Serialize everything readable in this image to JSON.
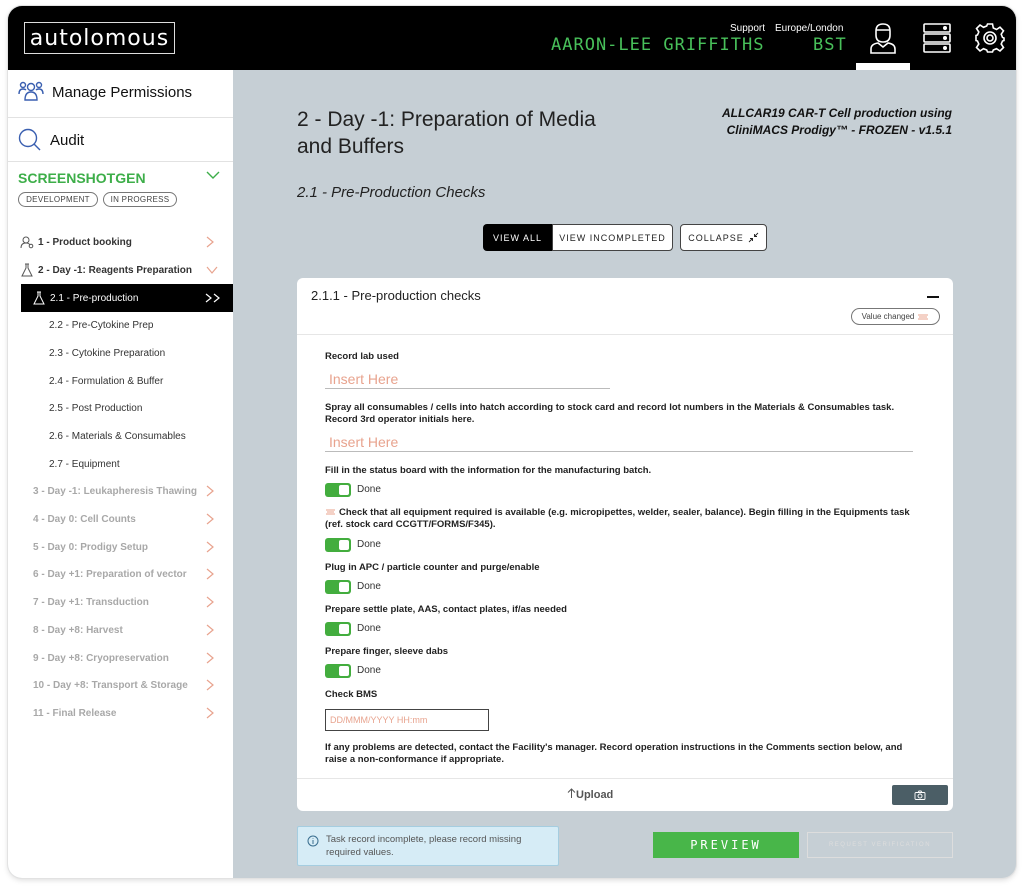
{
  "header": {
    "logo": "autolomous",
    "support": "Support",
    "timezone": "Europe/London",
    "user": "AARON-LEE GRIFFITHS",
    "tz_abbr": "BST"
  },
  "sidebar": {
    "manage_permissions": "Manage Permissions",
    "audit": "Audit",
    "project": "SCREENSHOTGEN",
    "pill_dev": "DEVELOPMENT",
    "pill_progress": "IN PROGRESS",
    "items": [
      {
        "label": "1 - Product booking"
      },
      {
        "label": "2 - Day -1: Reagents Preparation"
      },
      {
        "label": "2.1 - Pre-production"
      },
      {
        "label": "2.2 - Pre-Cytokine Prep"
      },
      {
        "label": "2.3 - Cytokine Preparation"
      },
      {
        "label": "2.4 - Formulation & Buffer"
      },
      {
        "label": "2.5 - Post Production"
      },
      {
        "label": "2.6 - Materials & Consumables"
      },
      {
        "label": "2.7 - Equipment"
      },
      {
        "label": "3 - Day -1: Leukapheresis Thawing"
      },
      {
        "label": "4 - Day 0: Cell Counts"
      },
      {
        "label": "5 - Day 0: Prodigy Setup"
      },
      {
        "label": "6 - Day +1: Preparation of vector"
      },
      {
        "label": "7 - Day +1: Transduction"
      },
      {
        "label": "8 - Day +8: Harvest"
      },
      {
        "label": "9 - Day +8: Cryopreservation"
      },
      {
        "label": "10 - Day +8: Transport & Storage"
      },
      {
        "label": "11 - Final Release"
      }
    ]
  },
  "main": {
    "page_title": "2 - Day -1: Preparation of Media and Buffers",
    "protocol_title": "ALLCAR19 CAR-T Cell production using CliniMACS Prodigy™ - FROZEN - v1.5.1",
    "section_title": "2.1 - Pre-Production Checks",
    "view_all": "VIEW ALL",
    "view_incompleted": "VIEW INCOMPLETED",
    "collapse": "COLLAPSE",
    "card": {
      "title": "2.1.1 - Pre-production checks",
      "value_changed": "Value changed",
      "lab_label": "Record lab used",
      "insert_placeholder": "Insert Here",
      "spray_label": "Spray all consumables / cells into hatch according to stock card and record lot numbers in the Materials & Consumables task. Record 3rd operator initials here.",
      "status_label": "Fill in the status board with the information for the manufacturing batch.",
      "equip_label": "Check that all equipment required is available (e.g. micropipettes, welder, sealer, balance). Begin filling in the Equipments task (ref. stock card CCGTT/FORMS/F345).",
      "apc_label": "Plug in APC / particle counter and purge/enable",
      "settle_label": "Prepare settle plate, AAS, contact plates, if/as needed",
      "finger_label": "Prepare finger, sleeve dabs",
      "bms_label": "Check BMS",
      "date_placeholder": "DD/MMM/YYYY HH:mm",
      "problems_text": "If any problems are detected, contact the Facility's manager. Record operation instructions in the Comments section below, and raise a non-conformance if appropriate.",
      "done": "Done",
      "upload": "Upload"
    },
    "info_text": "Task record incomplete, please record missing required values.",
    "preview": "PREVIEW",
    "request_verification": "REQUEST VERIFICATION"
  },
  "colors": {
    "accent_green": "#48b649",
    "header_green": "#48c05a",
    "placeholder": "#e8a38e",
    "main_bg": "#c6cfd5"
  }
}
